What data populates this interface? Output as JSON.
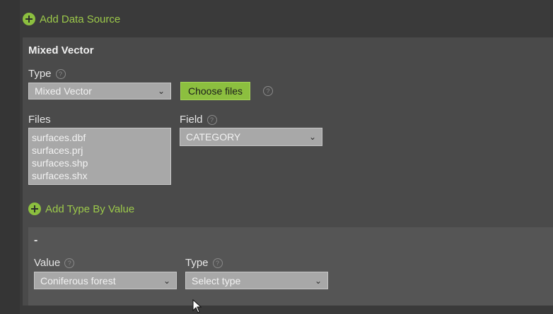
{
  "header": {
    "add_data_source": "Add Data Source"
  },
  "source": {
    "title": "Mixed Vector",
    "type_label": "Type",
    "type_value": "Mixed Vector",
    "choose_files": "Choose files",
    "files_label": "Files",
    "files": [
      "surfaces.dbf",
      "surfaces.prj",
      "surfaces.shp",
      "surfaces.shx"
    ],
    "field_label": "Field",
    "field_value": "CATEGORY",
    "add_type_by_value": "Add Type By Value"
  },
  "type_by_value": {
    "title": "-",
    "value_label": "Value",
    "value_selected": "Coniferous forest",
    "type_label": "Type",
    "type_placeholder": "Select type"
  },
  "icons": {
    "help": "?",
    "chevron": "⌄"
  },
  "colors": {
    "background": "#3a3a3a",
    "panel": "#4a4a4a",
    "subpanel": "#555555",
    "accent": "#8cbf3f",
    "link": "#9cc94a"
  }
}
